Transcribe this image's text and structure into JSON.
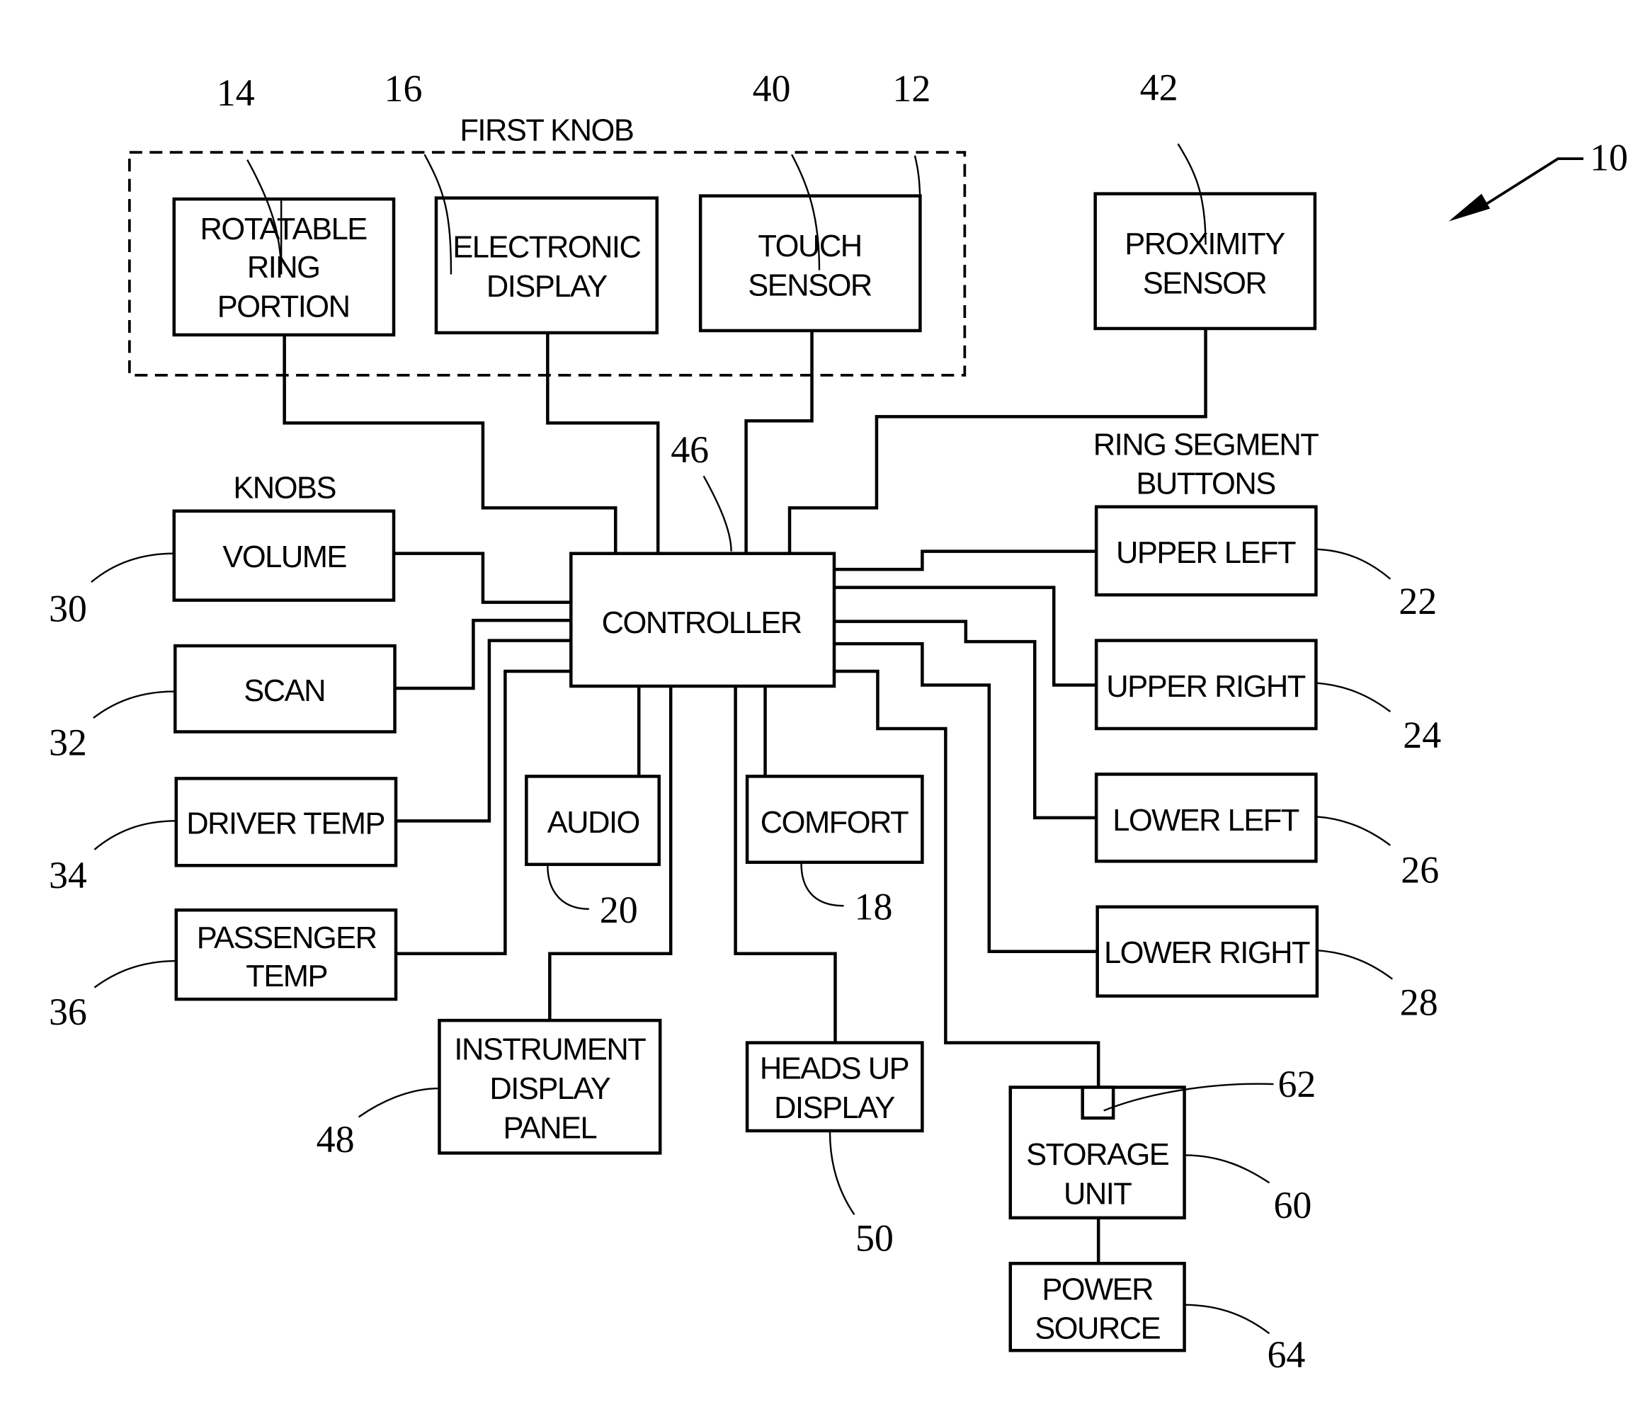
{
  "figure": {
    "reference": "10",
    "group_first_knob": {
      "caption": "FIRST KNOB",
      "ref": "12"
    },
    "group_knobs": {
      "caption": "KNOBS"
    },
    "group_ring_buttons": {
      "caption_line1": "RING SEGMENT",
      "caption_line2": "BUTTONS"
    },
    "blocks": {
      "rotatable_ring": {
        "lines": [
          "ROTATABLE",
          "RING",
          "PORTION"
        ],
        "ref": "14"
      },
      "electronic_display": {
        "lines": [
          "ELECTRONIC",
          "DISPLAY"
        ],
        "ref": "16"
      },
      "touch_sensor": {
        "lines": [
          "TOUCH",
          "SENSOR"
        ],
        "ref": "40"
      },
      "proximity_sensor": {
        "lines": [
          "PROXIMITY",
          "SENSOR"
        ],
        "ref": "42"
      },
      "controller": {
        "lines": [
          "CONTROLLER"
        ],
        "ref": "46"
      },
      "volume": {
        "lines": [
          "VOLUME"
        ],
        "ref": "30"
      },
      "scan": {
        "lines": [
          "SCAN"
        ],
        "ref": "32"
      },
      "driver_temp": {
        "lines": [
          "DRIVER TEMP"
        ],
        "ref": "34"
      },
      "passenger_temp": {
        "lines": [
          "PASSENGER",
          "TEMP"
        ],
        "ref": "36"
      },
      "audio": {
        "lines": [
          "AUDIO"
        ],
        "ref": "20"
      },
      "comfort": {
        "lines": [
          "COMFORT"
        ],
        "ref": "18"
      },
      "instrument_display_panel": {
        "lines": [
          "INSTRUMENT",
          "DISPLAY",
          "PANEL"
        ],
        "ref": "48"
      },
      "heads_up_display": {
        "lines": [
          "HEADS UP",
          "DISPLAY"
        ],
        "ref": "50"
      },
      "upper_left": {
        "lines": [
          "UPPER LEFT"
        ],
        "ref": "22"
      },
      "upper_right": {
        "lines": [
          "UPPER RIGHT"
        ],
        "ref": "24"
      },
      "lower_left": {
        "lines": [
          "LOWER LEFT"
        ],
        "ref": "26"
      },
      "lower_right": {
        "lines": [
          "LOWER RIGHT"
        ],
        "ref": "28"
      },
      "storage_unit": {
        "lines": [
          "STORAGE",
          "UNIT"
        ],
        "ref": "60",
        "port_ref": "62"
      },
      "power_source": {
        "lines": [
          "POWER",
          "SOURCE"
        ],
        "ref": "64"
      }
    }
  }
}
